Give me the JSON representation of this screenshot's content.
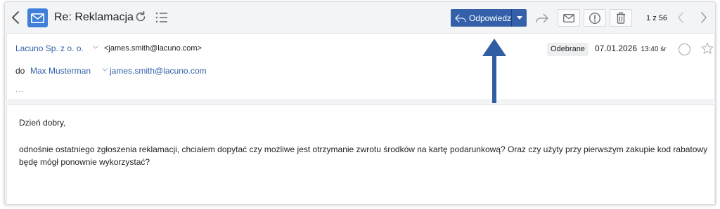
{
  "toolbar": {
    "subject": "Re: Reklamacja",
    "reply_label": "Odpowiedz",
    "pager": {
      "current": "1",
      "separator": "z",
      "total": "56"
    }
  },
  "header": {
    "sender_name": "Lacuno Sp. z o. o.",
    "sender_email": "<james.smith@lacuno.com>",
    "folder_badge": "Odebrane",
    "date": "07.01.2026",
    "time": "13:40 śr",
    "to_label": "do",
    "recipient_name": "Max Musterman",
    "recipient_email": "james.smith@lacuno.com",
    "more": "..."
  },
  "body": {
    "greeting": "Dzień dobry,",
    "paragraph": "odnośnie ostatniego zgłoszenia reklamacji, chciałem dopytać czy możliwe jest otrzymanie zwrotu środków na kartę podarunkową? Oraz czy użyty przy pierwszym zakupie kod rabatowy będę mógł ponownie wykorzystać?"
  },
  "colors": {
    "accent": "#3360a9",
    "mail_badge": "#3f7fd9",
    "annotation_arrow": "#2f5ea3"
  },
  "icons": [
    "back-icon",
    "mail-icon",
    "refresh-icon",
    "list-icon",
    "reply-icon",
    "chevron-down-icon",
    "forward-icon",
    "envelope-icon",
    "alert-icon",
    "trash-icon",
    "chevron-left-icon",
    "chevron-right-icon",
    "circle-icon",
    "star-icon",
    "arrow-up-icon"
  ]
}
